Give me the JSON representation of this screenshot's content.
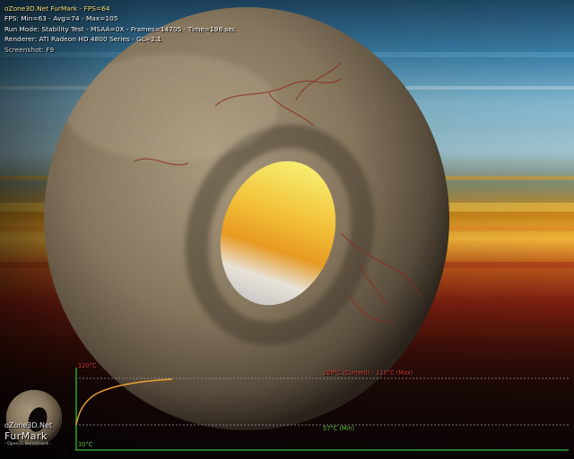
{
  "hud": {
    "title": "oZone3D.Net FurMark - FPS=64",
    "fps_stats": "FPS: Min=63 - Avg=74 - Max=105",
    "run_mode": "Run Mode: Stability Test - MSAA=0X - Frames=14705 - Time=198 sec",
    "renderer": "Renderer: ATI Radeon HD 4800 Series - GL=2.1",
    "screenshot_hint": "Screenshot: F9"
  },
  "temperature_graph": {
    "max_scale_label": "120°C",
    "min_scale_label": "30°C",
    "current_label": "109°C (Current) - 110°C (Max)",
    "min_label": "57°C (Min)",
    "colors": {
      "curve": "#e8a030",
      "max_text": "#d23a2a",
      "min_text": "#5fbf3a",
      "axis": "#2fa02f"
    }
  },
  "logo": {
    "site": "oZone3D.Net",
    "name": "FurMark",
    "tagline": "- OpenGL Benchmark -"
  }
}
